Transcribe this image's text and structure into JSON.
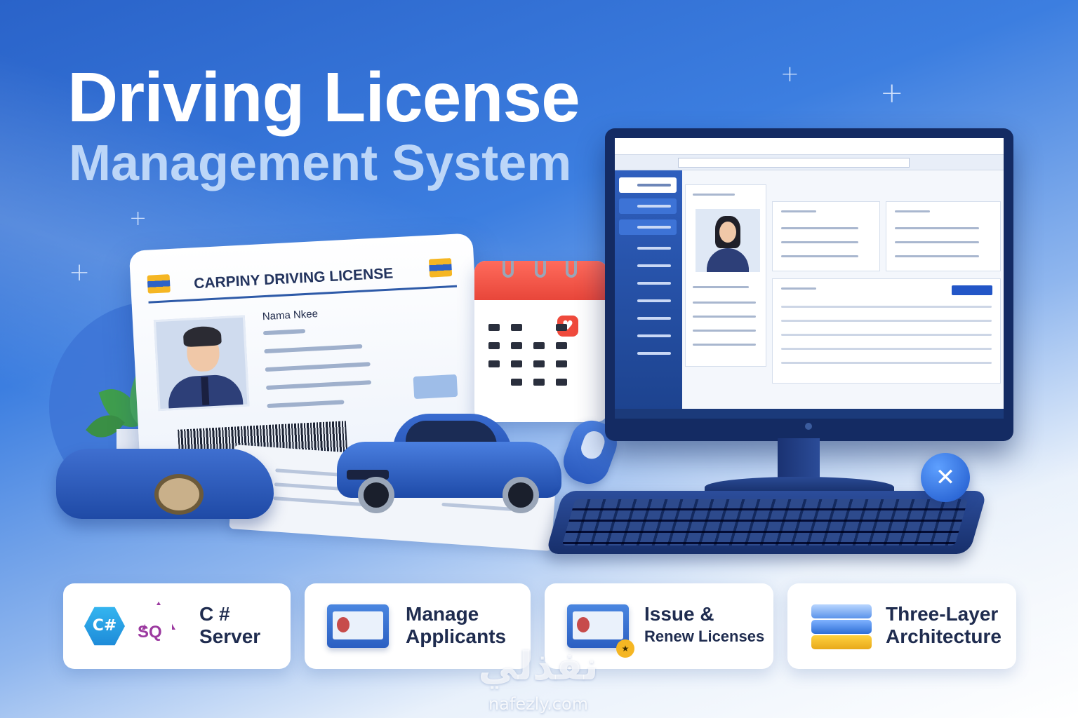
{
  "title": {
    "line1": "Driving License",
    "line2": "Management System"
  },
  "license_card": {
    "title": "CARPINY DRIVING LICENSE",
    "name_label": "Nama Nkee"
  },
  "features": [
    {
      "icon": "csharp-sql-server-icon",
      "label_line1": "C #",
      "label_line2": "Server",
      "icon_text_1": "C#",
      "icon_text_2": "SQ"
    },
    {
      "icon": "license-card-icon",
      "label_line1": "Manage",
      "label_line2": "Applicants"
    },
    {
      "icon": "license-card-badge-icon",
      "label_line1": "Issue &",
      "label_line2": "Renew Licenses"
    },
    {
      "icon": "stacked-layers-icon",
      "label_line1": "Three-Layer",
      "label_line2": "Architecture"
    }
  ],
  "watermark": {
    "arabic": "نفذلي",
    "latin": "nafezly.com"
  },
  "colors": {
    "primary_blue": "#2a63c9",
    "accent_red": "#e8463a",
    "accent_yellow": "#f5b623",
    "sql_purple": "#9c3aa0",
    "csharp_blue": "#1d8ad8"
  }
}
